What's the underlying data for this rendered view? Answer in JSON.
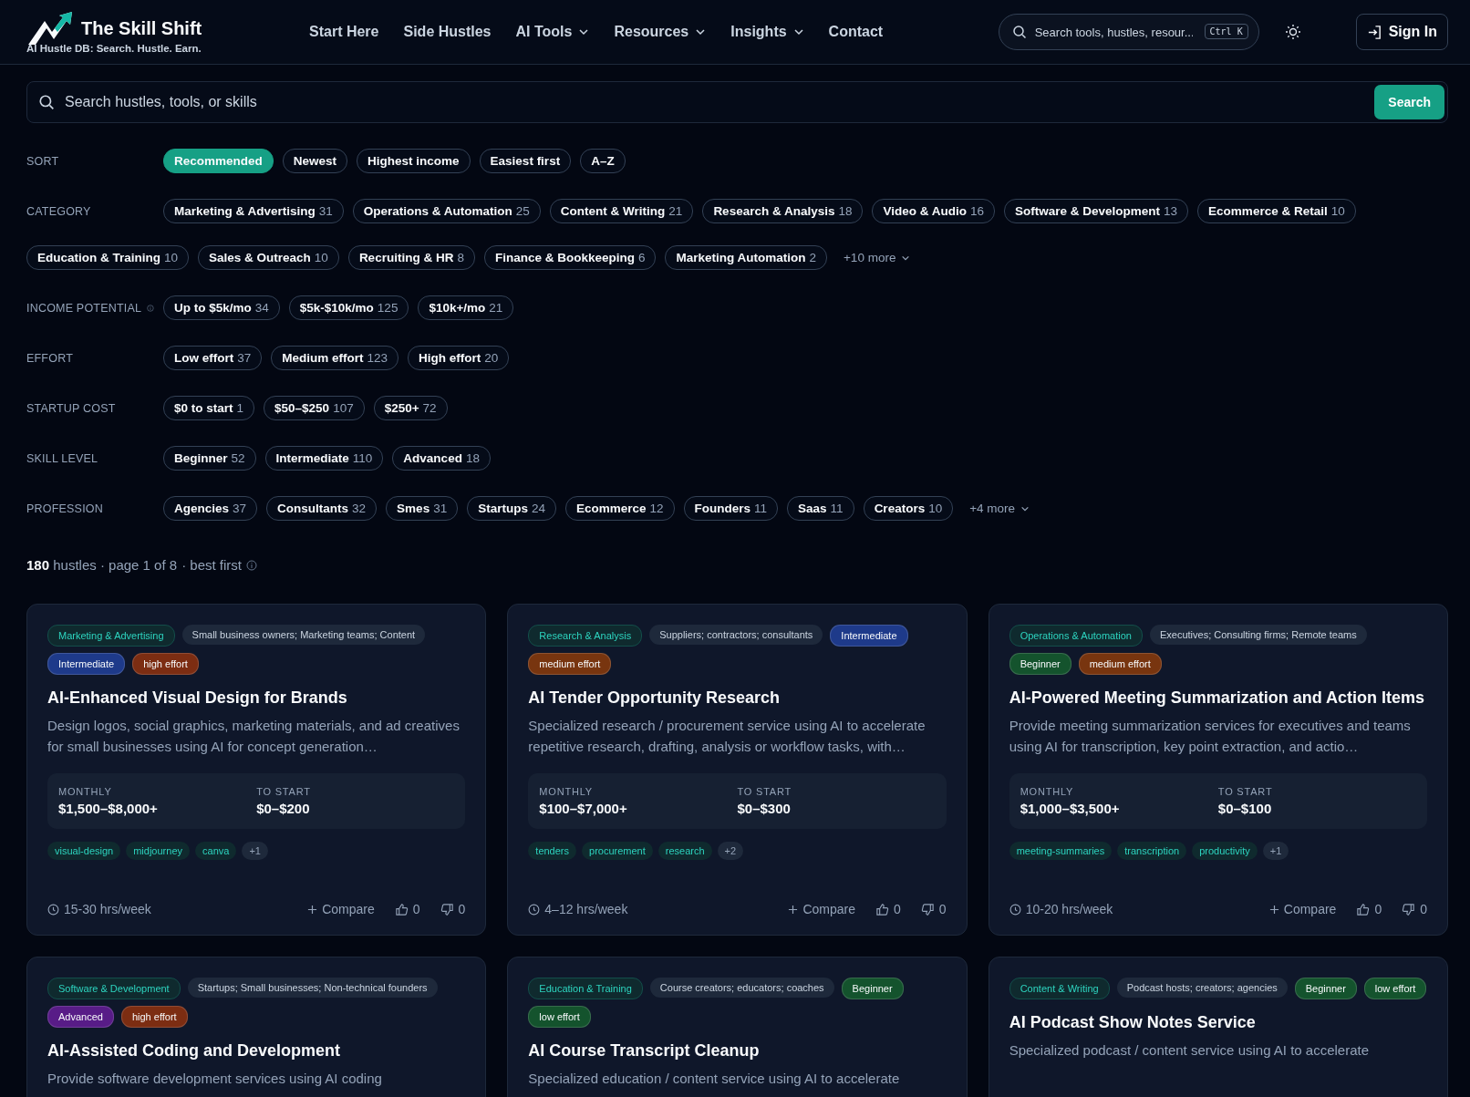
{
  "brand": {
    "name": "The Skill Shift",
    "tagline": "AI Hustle DB: Search. Hustle. Earn."
  },
  "nav": [
    {
      "label": "Start Here",
      "dropdown": false
    },
    {
      "label": "Side Hustles",
      "dropdown": false
    },
    {
      "label": "AI Tools",
      "dropdown": true
    },
    {
      "label": "Resources",
      "dropdown": true
    },
    {
      "label": "Insights",
      "dropdown": true
    },
    {
      "label": "Contact",
      "dropdown": false
    }
  ],
  "header_search": {
    "placeholder": "Search tools, hustles, resour...",
    "shortcut": "Ctrl K"
  },
  "sign_in": "Sign In",
  "search": {
    "placeholder": "Search hustles, tools, or skills",
    "button": "Search"
  },
  "filters": [
    {
      "label": "SORT",
      "info": false,
      "options": [
        {
          "label": "Recommended",
          "selected": true
        },
        {
          "label": "Newest",
          "selected": false
        },
        {
          "label": "Highest income",
          "selected": false
        },
        {
          "label": "Easiest first",
          "selected": false
        },
        {
          "label": "A–Z",
          "selected": false
        }
      ]
    },
    {
      "label": "CATEGORY",
      "info": false,
      "options": [
        {
          "label": "Marketing & Advertising",
          "count": "31"
        },
        {
          "label": "Operations & Automation",
          "count": "25"
        },
        {
          "label": "Content & Writing",
          "count": "21"
        },
        {
          "label": "Research & Analysis",
          "count": "18"
        },
        {
          "label": "Video & Audio",
          "count": "16"
        },
        {
          "label": "Software & Development",
          "count": "13"
        },
        {
          "label": "Ecommerce & Retail",
          "count": "10"
        },
        {
          "label": "Education & Training",
          "count": "10"
        },
        {
          "label": "Sales & Outreach",
          "count": "10"
        },
        {
          "label": "Recruiting & HR",
          "count": "8"
        },
        {
          "label": "Finance & Bookkeeping",
          "count": "6"
        },
        {
          "label": "Marketing Automation",
          "count": "2"
        }
      ],
      "more": "+10 more"
    },
    {
      "label": "INCOME POTENTIAL",
      "info": true,
      "options": [
        {
          "label": "Up to $5k/mo",
          "count": "34"
        },
        {
          "label": "$5k-$10k/mo",
          "count": "125"
        },
        {
          "label": "$10k+/mo",
          "count": "21"
        }
      ]
    },
    {
      "label": "EFFORT",
      "info": false,
      "options": [
        {
          "label": "Low effort",
          "count": "37"
        },
        {
          "label": "Medium effort",
          "count": "123"
        },
        {
          "label": "High effort",
          "count": "20"
        }
      ]
    },
    {
      "label": "STARTUP COST",
      "info": false,
      "options": [
        {
          "label": "$0 to start",
          "count": "1"
        },
        {
          "label": "$50–$250",
          "count": "107"
        },
        {
          "label": "$250+",
          "count": "72"
        }
      ]
    },
    {
      "label": "SKILL LEVEL",
      "info": false,
      "options": [
        {
          "label": "Beginner",
          "count": "52"
        },
        {
          "label": "Intermediate",
          "count": "110"
        },
        {
          "label": "Advanced",
          "count": "18"
        }
      ]
    },
    {
      "label": "PROFESSION",
      "info": false,
      "options": [
        {
          "label": "Agencies",
          "count": "37"
        },
        {
          "label": "Consultants",
          "count": "32"
        },
        {
          "label": "Smes",
          "count": "31"
        },
        {
          "label": "Startups",
          "count": "24"
        },
        {
          "label": "Ecommerce",
          "count": "12"
        },
        {
          "label": "Founders",
          "count": "11"
        },
        {
          "label": "Saas",
          "count": "11"
        },
        {
          "label": "Creators",
          "count": "10"
        }
      ],
      "more": "+4 more"
    }
  ],
  "summary": {
    "count": "180",
    "text": "hustles · page 1 of 8",
    "order": "· best first"
  },
  "cards": [
    {
      "tags": [
        {
          "kind": "category",
          "text": "Marketing & Advertising"
        },
        {
          "kind": "audience",
          "text": "Small business owners; Marketing teams; Content"
        },
        {
          "kind": "badge",
          "text": "Intermediate",
          "color": "#1e3a8a"
        },
        {
          "kind": "badge",
          "text": "high effort",
          "color": "#7c2d12"
        }
      ],
      "title": "AI-Enhanced Visual Design for Brands",
      "description": "Design logos, social graphics, marketing materials, and ad creatives for small businesses using AI for concept generation…",
      "stats": [
        {
          "label": "MONTHLY",
          "value": "$1,500–$8,000+"
        },
        {
          "label": "TO START",
          "value": "$0–$200"
        }
      ],
      "keywords": [
        {
          "text": "visual-design",
          "kind": "keyword"
        },
        {
          "text": "midjourney",
          "kind": "keyword"
        },
        {
          "text": "canva",
          "kind": "keyword"
        },
        {
          "text": "+1",
          "kind": "more"
        }
      ],
      "time": "15-30 hrs/week",
      "compare": "Compare",
      "likes": "0",
      "dislikes": "0"
    },
    {
      "tags": [
        {
          "kind": "category",
          "text": "Research & Analysis"
        },
        {
          "kind": "audience",
          "text": "Suppliers; contractors; consultants"
        },
        {
          "kind": "badge",
          "text": "Intermediate",
          "color": "#1e3a8a"
        },
        {
          "kind": "badge",
          "text": "medium effort",
          "color": "#78350f"
        }
      ],
      "title": "AI Tender Opportunity Research",
      "description": "Specialized research / procurement service using AI to accelerate repetitive research, drafting, analysis or workflow tasks, with…",
      "stats": [
        {
          "label": "MONTHLY",
          "value": "$100–$7,000+"
        },
        {
          "label": "TO START",
          "value": "$0–$300"
        }
      ],
      "keywords": [
        {
          "text": "tenders",
          "kind": "keyword"
        },
        {
          "text": "procurement",
          "kind": "keyword"
        },
        {
          "text": "research",
          "kind": "keyword"
        },
        {
          "text": "+2",
          "kind": "more"
        }
      ],
      "time": "4–12 hrs/week",
      "compare": "Compare",
      "likes": "0",
      "dislikes": "0"
    },
    {
      "tags": [
        {
          "kind": "category",
          "text": "Operations & Automation"
        },
        {
          "kind": "audience",
          "text": "Executives; Consulting firms; Remote teams"
        },
        {
          "kind": "badge",
          "text": "Beginner",
          "color": "#14532d"
        },
        {
          "kind": "badge",
          "text": "medium effort",
          "color": "#78350f"
        }
      ],
      "title": "AI-Powered Meeting Summarization and Action Items",
      "description": "Provide meeting summarization services for executives and teams using AI for transcription, key point extraction, and actio…",
      "stats": [
        {
          "label": "MONTHLY",
          "value": "$1,000–$3,500+"
        },
        {
          "label": "TO START",
          "value": "$0–$100"
        }
      ],
      "keywords": [
        {
          "text": "meeting-summaries",
          "kind": "keyword"
        },
        {
          "text": "transcription",
          "kind": "keyword"
        },
        {
          "text": "productivity",
          "kind": "keyword"
        },
        {
          "text": "+1",
          "kind": "more"
        }
      ],
      "time": "10-20 hrs/week",
      "compare": "Compare",
      "likes": "0",
      "dislikes": "0"
    },
    {
      "tags": [
        {
          "kind": "category",
          "text": "Software & Development"
        },
        {
          "kind": "audience",
          "text": "Startups; Small businesses; Non-technical founders"
        },
        {
          "kind": "badge",
          "text": "Advanced",
          "color": "#581c87"
        },
        {
          "kind": "badge",
          "text": "high effort",
          "color": "#7c2d12"
        }
      ],
      "title": "AI-Assisted Coding and Development",
      "description": "Provide software development services using AI coding"
    },
    {
      "tags": [
        {
          "kind": "category",
          "text": "Education & Training"
        },
        {
          "kind": "audience",
          "text": "Course creators; educators; coaches"
        },
        {
          "kind": "badge",
          "text": "Beginner",
          "color": "#14532d"
        },
        {
          "kind": "badge",
          "text": "low effort",
          "color": "#14532d"
        }
      ],
      "title": "AI Course Transcript Cleanup",
      "description": "Specialized education / content service using AI to accelerate"
    },
    {
      "tags": [
        {
          "kind": "category",
          "text": "Content & Writing"
        },
        {
          "kind": "audience",
          "text": "Podcast hosts; creators; agencies"
        },
        {
          "kind": "badge",
          "text": "Beginner",
          "color": "#14532d"
        },
        {
          "kind": "badge",
          "text": "low effort",
          "color": "#14532d"
        }
      ],
      "title": "AI Podcast Show Notes Service",
      "description": "Specialized podcast / content service using AI to accelerate"
    }
  ]
}
